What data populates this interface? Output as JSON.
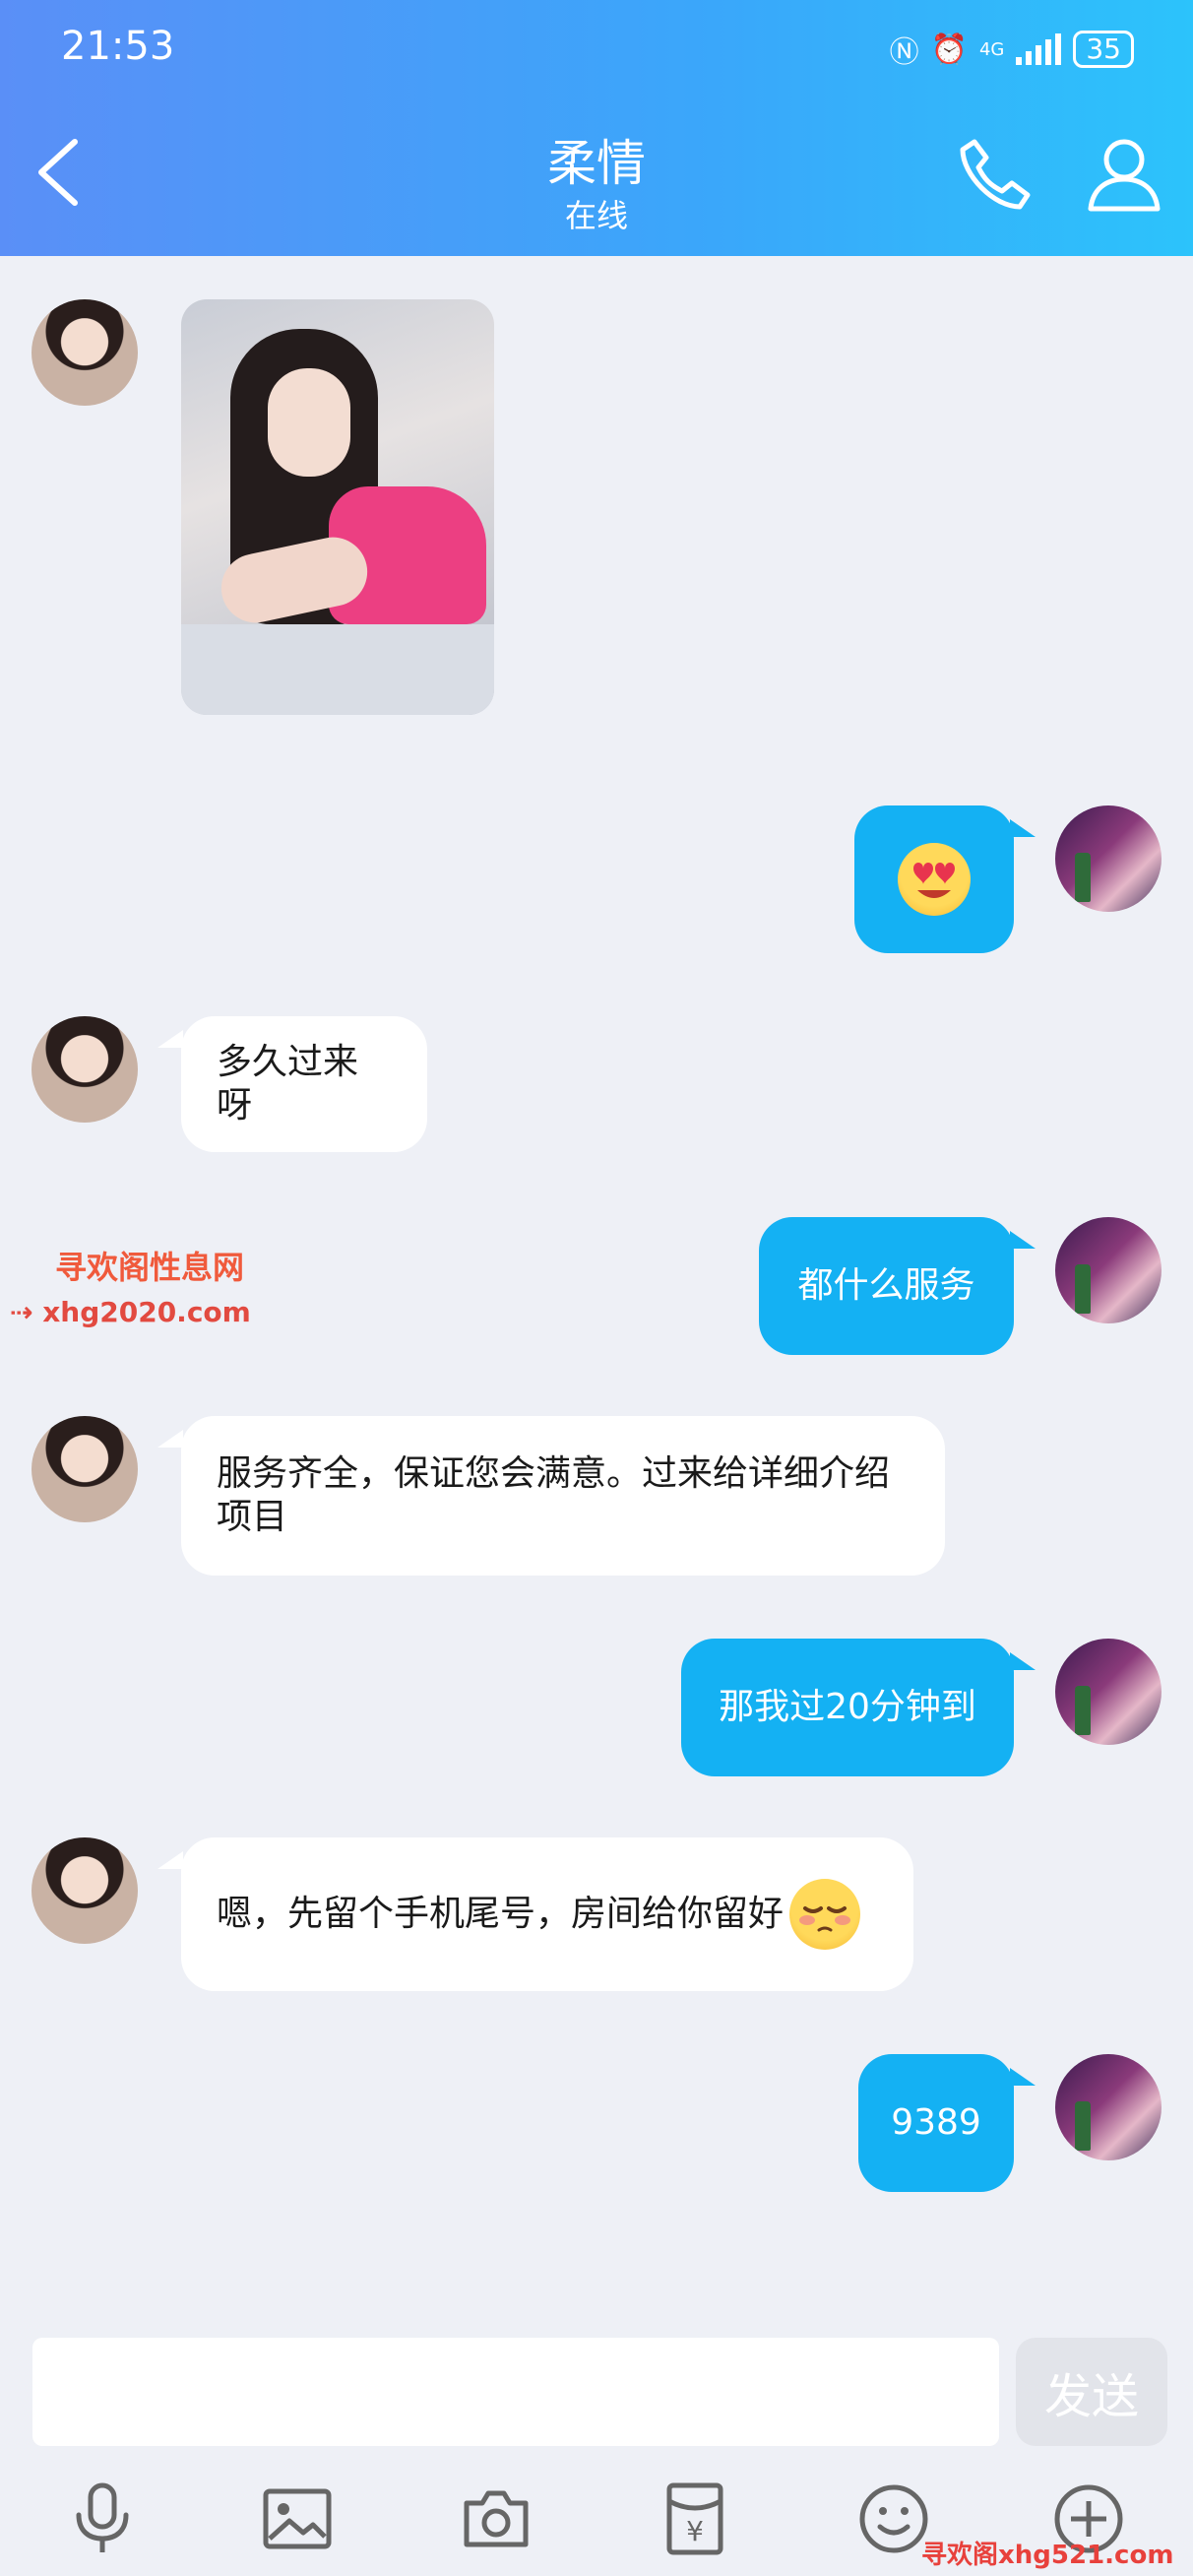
{
  "status_bar": {
    "time": "21:53",
    "network": "4G",
    "battery": "35"
  },
  "header": {
    "title": "柔情",
    "subtitle": "在线"
  },
  "messages": [
    {
      "side": "in",
      "type": "image"
    },
    {
      "side": "out",
      "type": "emoji",
      "emoji": "heart-eyes-emoji"
    },
    {
      "side": "in",
      "text": "多久过来呀"
    },
    {
      "side": "out",
      "text": "都什么服务"
    },
    {
      "side": "in",
      "text_line1": "服务齐全，保证您会满意。过来给详细介绍",
      "text_line2": "项目"
    },
    {
      "side": "out",
      "text": "那我过20分钟到"
    },
    {
      "side": "in",
      "text": "嗯，先留个手机尾号，房间给你留好",
      "emoji": "shy-emoji"
    },
    {
      "side": "out",
      "text": "9389"
    }
  ],
  "watermark": {
    "name": "寻欢阁性息网",
    "site": "xhg2020.com",
    "footer": "寻欢阁xhg521.com"
  },
  "composer": {
    "send_label": "发送",
    "input_value": ""
  },
  "toolbar": [
    "microphone-icon",
    "image-icon",
    "camera-icon",
    "red-packet-icon",
    "emoji-icon",
    "plus-icon"
  ],
  "colors": {
    "header_start": "#5a8ff7",
    "header_end": "#2cc3fb",
    "out_bubble": "#14b1f3",
    "in_bubble": "#ffffff",
    "background": "#eef0f6"
  }
}
